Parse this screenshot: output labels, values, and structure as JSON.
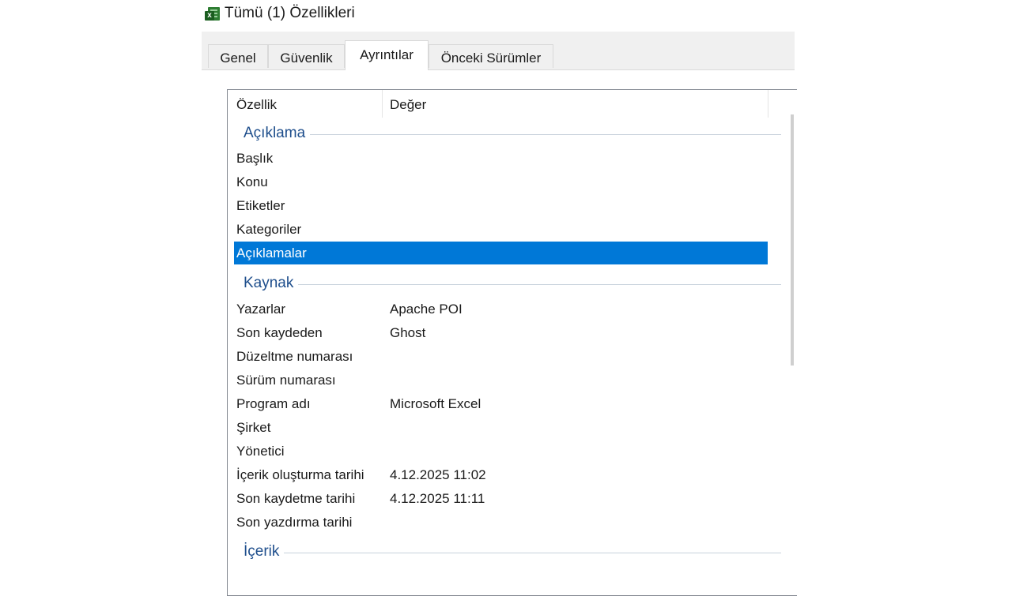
{
  "window": {
    "title": "Tümü (1) Özellikleri",
    "icon": "excel-file-icon"
  },
  "tabs": [
    {
      "label": "Genel"
    },
    {
      "label": "Güvenlik"
    },
    {
      "label": "Ayrıntılar",
      "active": true
    },
    {
      "label": "Önceki Sürümler"
    }
  ],
  "table": {
    "headers": {
      "property": "Özellik",
      "value": "Değer"
    },
    "groups": {
      "aciklama": "Açıklama",
      "kaynak": "Kaynak",
      "icerik": "İçerik"
    },
    "rows": [
      {
        "key": "Başlık",
        "value": ""
      },
      {
        "key": "Konu",
        "value": ""
      },
      {
        "key": "Etiketler",
        "value": ""
      },
      {
        "key": "Kategoriler",
        "value": ""
      },
      {
        "key": "Açıklamalar",
        "value": "",
        "selected": true
      },
      {
        "key": "Yazarlar",
        "value": "Apache POI"
      },
      {
        "key": "Son kaydeden",
        "value": "Ghost"
      },
      {
        "key": "Düzeltme numarası",
        "value": ""
      },
      {
        "key": "Sürüm numarası",
        "value": ""
      },
      {
        "key": "Program adı",
        "value": "Microsoft Excel"
      },
      {
        "key": "Şirket",
        "value": ""
      },
      {
        "key": "Yönetici",
        "value": ""
      },
      {
        "key": "İçerik oluşturma tarihi",
        "value": "4.12.2025 11:02"
      },
      {
        "key": "Son kaydetme tarihi",
        "value": "4.12.2025 11:11"
      },
      {
        "key": "Son yazdırma tarihi",
        "value": ""
      }
    ]
  },
  "colors": {
    "selection": "#0078d7",
    "group_header": "#1e4e8c"
  }
}
